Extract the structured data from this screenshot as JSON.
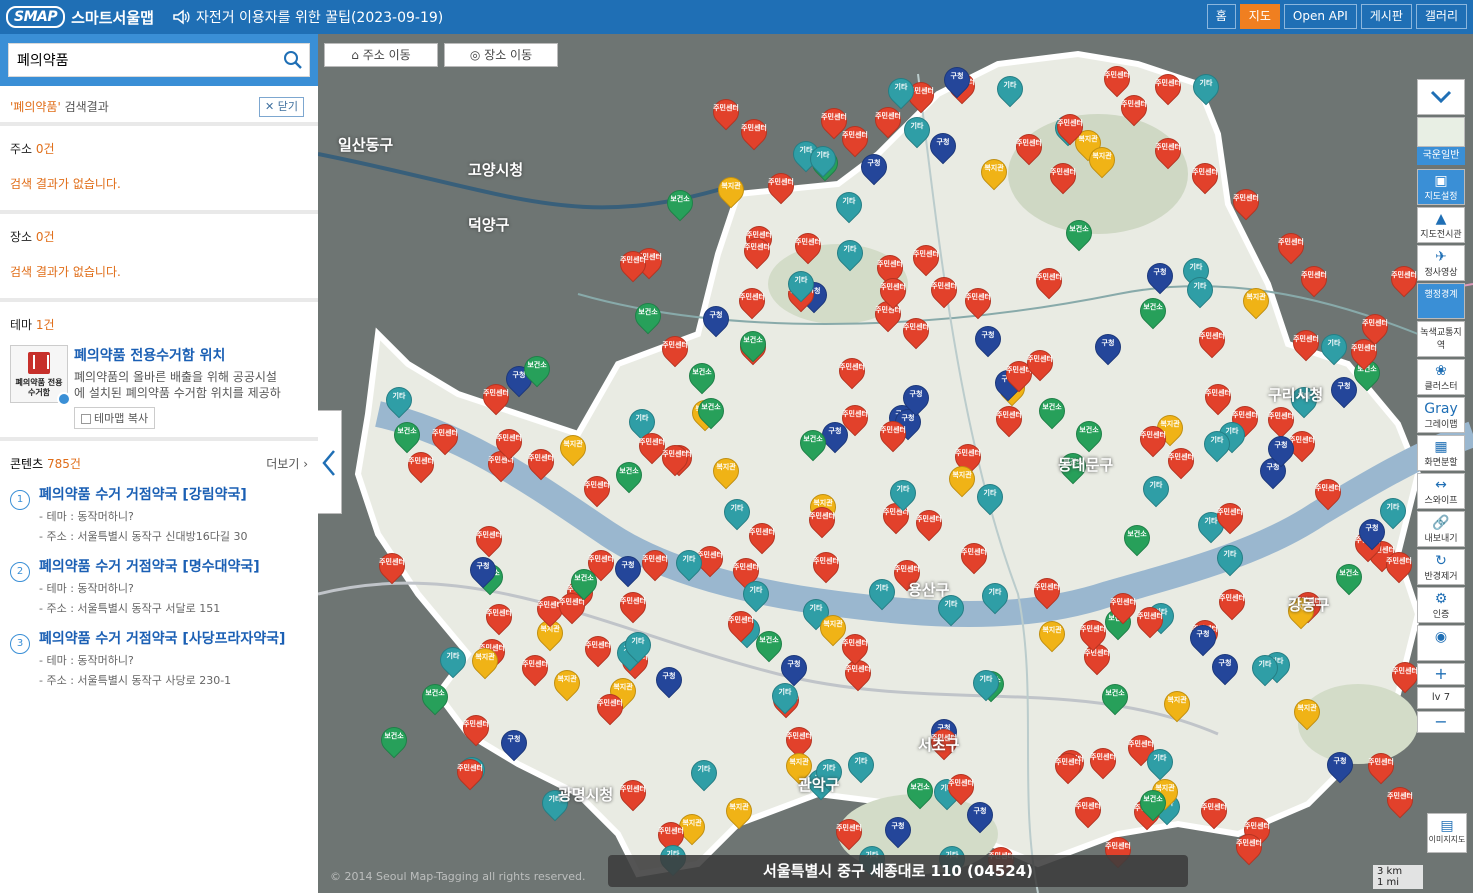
{
  "header": {
    "logo_mark": "SMAP",
    "logo_text": "스마트서울맵",
    "notice": "자전거 이용자를 위한 꿀팁(2023-09-19)",
    "nav": [
      "홈",
      "지도",
      "Open API",
      "게시판",
      "갤러리"
    ],
    "active_nav": "지도"
  },
  "search": {
    "query": "폐의약품"
  },
  "result_head": {
    "keyword": "'폐의약품'",
    "suffix": " 검색결과",
    "close": "닫기"
  },
  "address_section": {
    "label": "주소",
    "count": "0건",
    "empty": "검색 결과가 없습니다."
  },
  "place_section": {
    "label": "장소",
    "count": "0건",
    "empty": "검색 결과가 없습니다."
  },
  "theme_section": {
    "label": "테마",
    "count": "1건",
    "thumb_caption": "폐의약품 전용수거함",
    "name": "폐의약품 전용수거함 위치",
    "desc_line1": "폐의약품의 올바른 배출을 위해 공공시설",
    "desc_line2": "에 설치된 폐의약품 수거함 위치를 제공하",
    "copy": "테마맵 복사"
  },
  "contents_section": {
    "label": "콘텐츠",
    "count": "785건",
    "more": "더보기 ›",
    "items": [
      {
        "num": "1",
        "title": "폐의약품 수거 거점약국 [강림약국]",
        "theme": "- 테마 : 동작머하니?",
        "addr": "- 주소 : 서울특별시 동작구 신대방16다길 30"
      },
      {
        "num": "2",
        "title": "폐의약품 수거 거점약국 [명수대약국]",
        "theme": "- 테마 : 동작머하니?",
        "addr": "- 주소 : 서울특별시 동작구 서달로 151"
      },
      {
        "num": "3",
        "title": "폐의약품 수거 거점약국 [사당프라자약국]",
        "theme": "- 테마 : 동작머하니?",
        "addr": "- 주소 : 서울특별시 동작구 사당로 230-1"
      }
    ]
  },
  "map": {
    "move_address": "주소 이동",
    "move_place": "장소 이동",
    "address_bar": "서울특별시 중구 세종대로 110 (04524)",
    "copyright": "© 2014 Seoul Map-Tagging all rights reserved.",
    "scale_km": "3 km",
    "scale_mi": "1 mi",
    "marker_labels": {
      "red": "주민센터",
      "teal": "기타",
      "yellow": "복지관",
      "navy": "구청",
      "green": "보건소"
    },
    "place_labels": [
      "고양시청",
      "일산동구",
      "덕양구",
      "구리시청",
      "광명시청",
      "용산구",
      "관악구",
      "동대문구",
      "서초구",
      "강동구"
    ]
  },
  "toolbar": {
    "basemap": "국운일반",
    "items": [
      {
        "icon": "layers-icon",
        "glyph": "▣",
        "label": "지도설정",
        "active": true
      },
      {
        "icon": "landscape-icon",
        "glyph": "▲",
        "label": "지도전시관",
        "active": false
      },
      {
        "icon": "plane-icon",
        "glyph": "✈",
        "label": "정사영상",
        "active": false
      },
      {
        "icon": "boundary-icon",
        "glyph": "",
        "label": "행정경계",
        "active": true
      },
      {
        "icon": "traffic-icon",
        "glyph": "",
        "label": "녹색교통지역",
        "active": false
      },
      {
        "icon": "cluster-icon",
        "glyph": "❀",
        "label": "클러스터",
        "active": false
      },
      {
        "icon": "gray-icon",
        "glyph": "Gray",
        "label": "그레이맵",
        "active": false
      },
      {
        "icon": "split-icon",
        "glyph": "▦",
        "label": "화면분할",
        "active": false
      },
      {
        "icon": "swipe-icon",
        "glyph": "↔",
        "label": "스와이프",
        "active": false
      },
      {
        "icon": "share-icon",
        "glyph": "🔗",
        "label": "내보내기",
        "active": false
      },
      {
        "icon": "radius-icon",
        "glyph": "↻",
        "label": "반경제거",
        "active": false
      },
      {
        "icon": "settings-icon",
        "glyph": "⚙",
        "label": "인증",
        "active": false
      }
    ],
    "level": "lv 7",
    "image_map": "이미지지도"
  }
}
